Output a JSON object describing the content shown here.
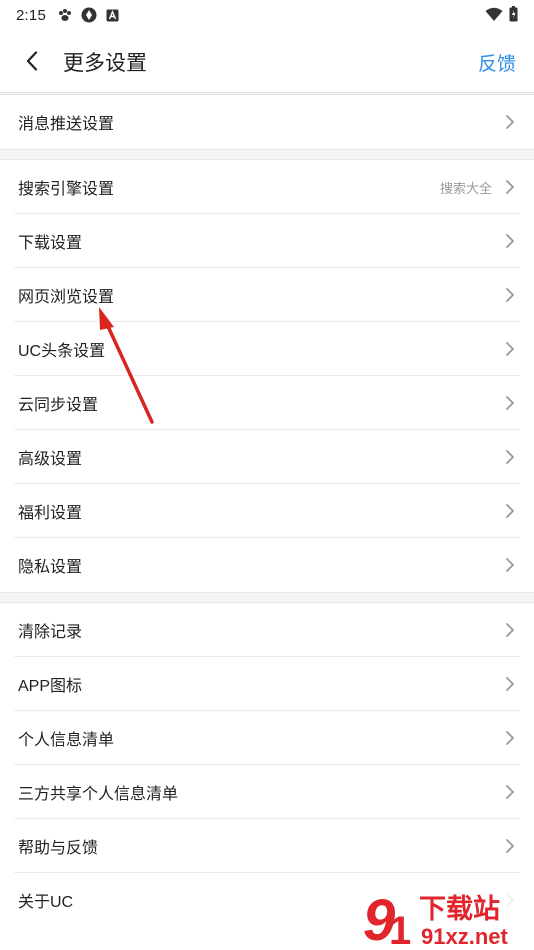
{
  "status_bar": {
    "time": "2:15"
  },
  "header": {
    "title": "更多设置",
    "feedback_label": "反馈"
  },
  "sections": [
    {
      "items": [
        {
          "label": "消息推送设置"
        }
      ]
    },
    {
      "items": [
        {
          "label": "搜索引擎设置",
          "value": "搜索大全"
        },
        {
          "label": "下载设置"
        },
        {
          "label": "网页浏览设置"
        },
        {
          "label": "UC头条设置"
        },
        {
          "label": "云同步设置"
        },
        {
          "label": "高级设置"
        },
        {
          "label": "福利设置"
        },
        {
          "label": "隐私设置"
        }
      ]
    },
    {
      "items": [
        {
          "label": "清除记录"
        },
        {
          "label": "APP图标"
        },
        {
          "label": "个人信息清单"
        },
        {
          "label": "三方共享个人信息清单"
        },
        {
          "label": "帮助与反馈"
        },
        {
          "label": "关于UC"
        }
      ]
    }
  ],
  "watermark": {
    "logo_text": "下载站",
    "site_text": "91xz.net"
  },
  "colors": {
    "accent": "#2e8ee8",
    "annotation_arrow": "#d9241f",
    "watermark": "#e0252c"
  }
}
